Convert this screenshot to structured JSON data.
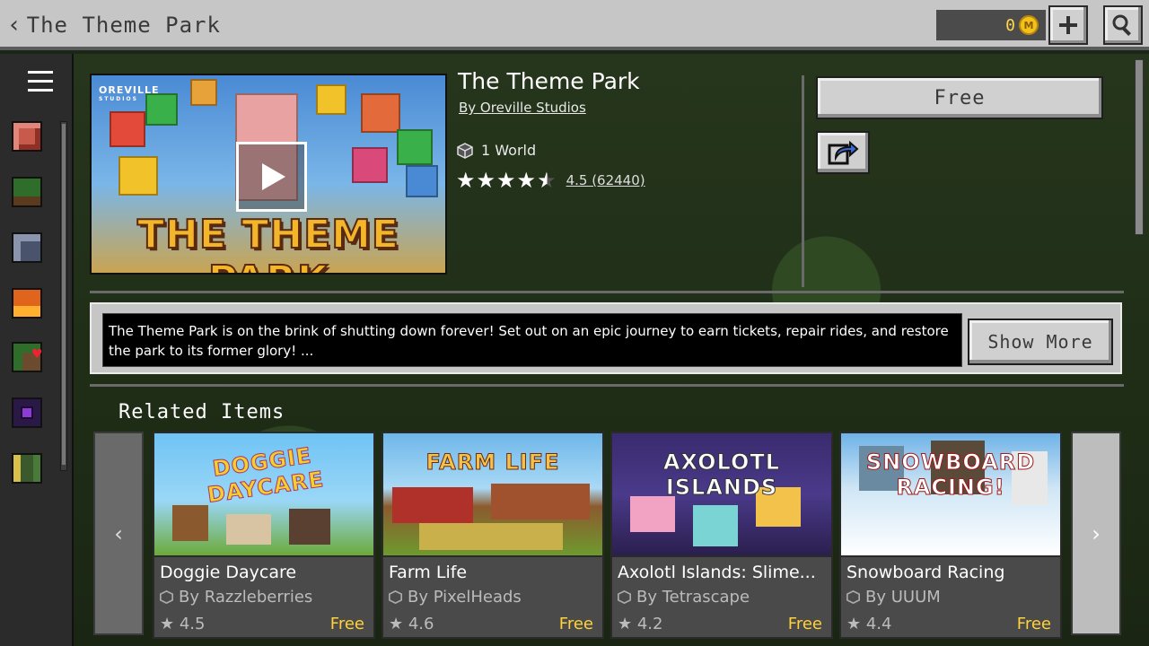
{
  "header": {
    "back_label": "‹",
    "title": "The Theme Park",
    "coins": "0",
    "coin_glyph": "M"
  },
  "sidebar": {
    "items": [
      "character-creator",
      "realms",
      "marketplace",
      "fire-pack",
      "villager-pack",
      "portal-pack",
      "library"
    ]
  },
  "product": {
    "art_title": "THE THEME PARK",
    "art_logo": "OREVILLE",
    "art_logo_sub": "STUDIOS",
    "title": "The Theme Park",
    "creator": "By Oreville Studios",
    "world_count": "1 World",
    "stars": "★★★★",
    "rating_text": "4.5 (62440)",
    "price_label": "Free"
  },
  "description": {
    "text": "The Theme Park is on the brink of shutting down forever! Set out on an epic journey to earn tickets, repair rides, and restore the park to its former glory! ...",
    "show_more_label": "Show More"
  },
  "related": {
    "title": "Related Items",
    "items": [
      {
        "art": "DOGGIE DAYCARE",
        "name": "Doggie Daycare",
        "author": "By Razzleberries",
        "rating": "★ 4.5",
        "price": "Free"
      },
      {
        "art": "FARM LIFE",
        "name": "Farm Life",
        "author": "By PixelHeads",
        "rating": "★ 4.6",
        "price": "Free"
      },
      {
        "art": "AXOLOTL ISLANDS",
        "name": "Axolotl Islands: Slime...",
        "author": "By Tetrascape",
        "rating": "★ 4.2",
        "price": "Free"
      },
      {
        "art": "SNOWBOARD RACING!",
        "name": "Snowboard Racing",
        "author": "By UUUM",
        "rating": "★ 4.4",
        "price": "Free"
      }
    ]
  },
  "colors": {
    "accent_price": "#ffd23a",
    "button_face": "#d0d0d0",
    "panel_dark": "#2b2b2b"
  }
}
